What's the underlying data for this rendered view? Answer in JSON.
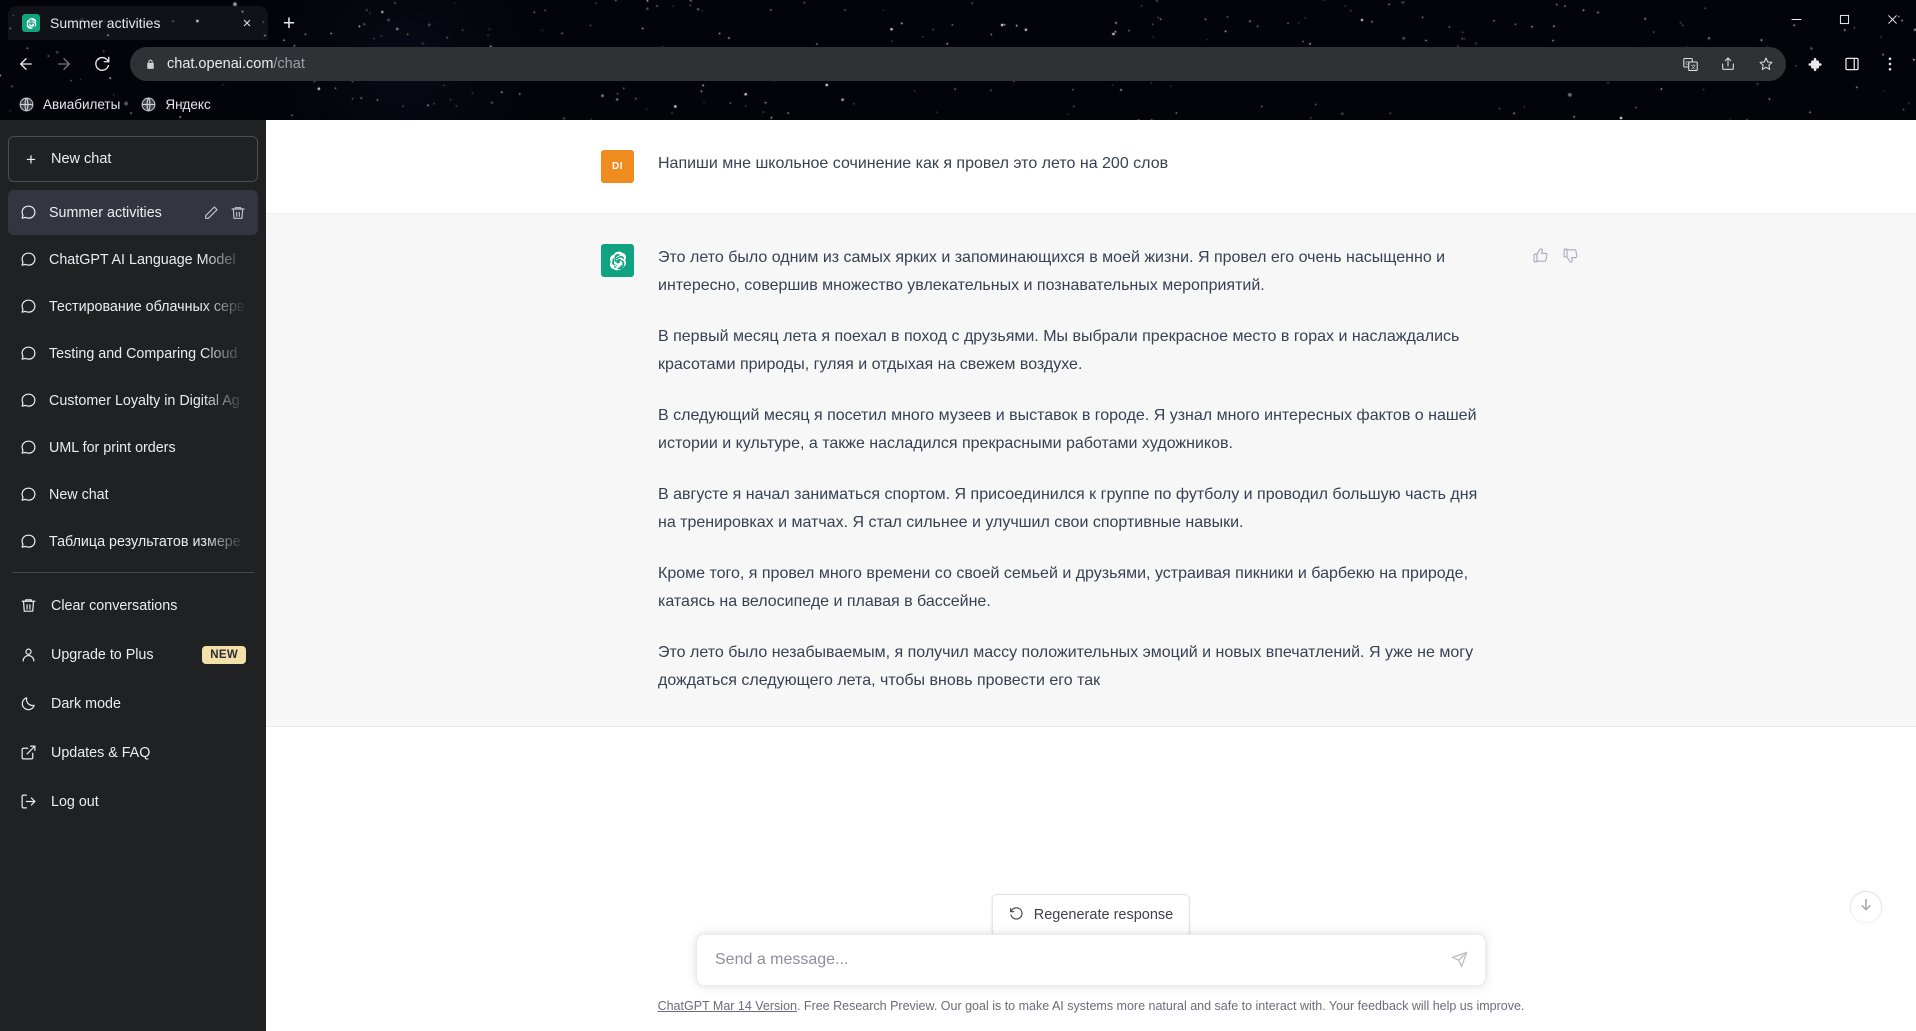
{
  "browser": {
    "tab": {
      "title": "Summer activities",
      "favicon": "openai-icon",
      "close": "×"
    },
    "new_tab_label": "+",
    "window_controls": {
      "minimize": "minimize-icon",
      "maximize": "maximize-icon",
      "close": "close-icon"
    },
    "nav": {
      "back": "back-arrow-icon",
      "forward": "forward-arrow-icon",
      "reload": "reload-icon"
    },
    "omnibox": {
      "lock": "lock-icon",
      "domain": "chat.openai.com",
      "path": "/chat",
      "actions": [
        "translate-icon",
        "share-icon",
        "bookmark-star-icon"
      ]
    },
    "toolbar_right": [
      "extensions-puzzle-icon",
      "browser-sidebar-icon",
      "three-dot-menu-icon"
    ],
    "bookmarks": [
      {
        "label": "Авиабилеты",
        "icon": "globe-icon"
      },
      {
        "label": "Яндекс",
        "icon": "globe-icon"
      }
    ]
  },
  "sidebar": {
    "new_chat_label": "New chat",
    "conversations": [
      {
        "label": "Summer activities",
        "active": true
      },
      {
        "label": "ChatGPT AI Language Model",
        "active": false
      },
      {
        "label": "Тестирование облачных серв",
        "active": false
      },
      {
        "label": "Testing and Comparing Cloud",
        "active": false
      },
      {
        "label": "Customer Loyalty in Digital Ag",
        "active": false
      },
      {
        "label": "UML for print orders",
        "active": false
      },
      {
        "label": "New chat",
        "active": false
      },
      {
        "label": "Таблица результатов измере",
        "active": false
      }
    ],
    "conversation_actions": {
      "edit": "pencil-icon",
      "delete": "trash-icon"
    },
    "menu": [
      {
        "label": "Clear conversations",
        "icon": "trash-icon",
        "badge": ""
      },
      {
        "label": "Upgrade to Plus",
        "icon": "user-icon",
        "badge": "NEW"
      },
      {
        "label": "Dark mode",
        "icon": "moon-icon",
        "badge": ""
      },
      {
        "label": "Updates & FAQ",
        "icon": "external-link-icon",
        "badge": ""
      },
      {
        "label": "Log out",
        "icon": "logout-icon",
        "badge": ""
      }
    ]
  },
  "conversation": {
    "user": {
      "avatar_initials": "DI",
      "text": "Напиши мне школьное сочинение как я провел это лето на 200 слов"
    },
    "assistant": {
      "avatar_icon": "openai-logo-icon",
      "paragraphs": [
        "Это лето было одним из самых ярких и запоминающихся в моей жизни. Я провел его очень насыщенно и интересно, совершив множество увлекательных и познавательных мероприятий.",
        "В первый месяц лета я поехал в поход с друзьями. Мы выбрали прекрасное место в горах и наслаждались красотами природы, гуляя и отдыхая на свежем воздухе.",
        "В следующий месяц я посетил много музеев и выставок в городе. Я узнал много интересных фактов о нашей истории и культуре, а также насладился прекрасными работами художников.",
        "В августе я начал заниматься спортом. Я присоединился к группе по футболу и проводил большую часть дня на тренировках и матчах. Я стал сильнее и улучшил свои спортивные навыки.",
        "Кроме того, я провел много времени со своей семьей и друзьями, устраивая пикники и барбекю на природе, катаясь на велосипеде и плавая в бассейне.",
        "Это лето было незабываемым, я получил массу положительных эмоций и новых впечатлений. Я уже не могу дождаться следующего лета, чтобы вновь провести его так"
      ],
      "feedback": {
        "like": "thumbs-up-icon",
        "dislike": "thumbs-down-icon"
      }
    }
  },
  "composer": {
    "regenerate_label": "Regenerate response",
    "regenerate_icon": "refresh-icon",
    "placeholder": "Send a message...",
    "value": "",
    "send_icon": "send-icon",
    "scroll_down_icon": "arrow-down-icon"
  },
  "footer": {
    "link_text": "ChatGPT Mar 14 Version",
    "note": ". Free Research Preview. Our goal is to make AI systems more natural and safe to interact with. Your feedback will help us improve."
  },
  "colors": {
    "accent_green": "#10a37f",
    "user_avatar_orange": "#ef8c20",
    "sidebar_bg": "#202123",
    "active_convo_bg": "#343541",
    "bot_msg_bg": "#f7f7f8",
    "badge_bg": "#f3e1a9"
  }
}
